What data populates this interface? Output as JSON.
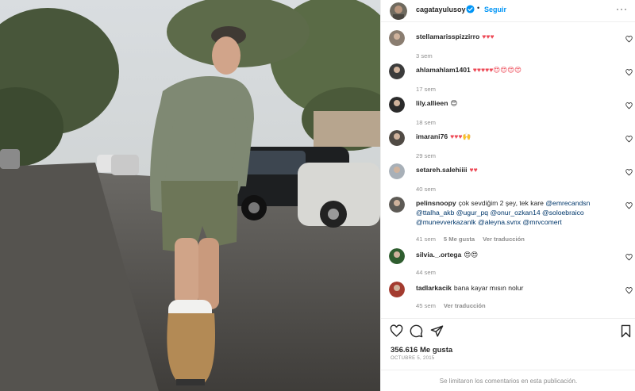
{
  "post": {
    "username": "cagatayulusoy",
    "follow_label": "Seguir",
    "separator": "•",
    "more_label": "···",
    "likes": "356.616 Me gusta",
    "date": "OCTUBRE 5, 2015",
    "comments_limited": "Se limitaron los comentarios en esta publicación."
  },
  "comments": [
    {
      "username": "stellamarisspizzirro",
      "text": "♥♥♥",
      "time": "3 sem",
      "likes": "",
      "action": ""
    },
    {
      "username": "ahlamahlam1401",
      "text": "♥♥♥♥♥😍😍😍😍",
      "time": "17 sem",
      "likes": "",
      "action": ""
    },
    {
      "username": "lily.allieen",
      "text": "😍",
      "time": "18 sem",
      "likes": "",
      "action": ""
    },
    {
      "username": "imarani76",
      "text": "♥♥♥🙌",
      "time": "29 sem",
      "likes": "",
      "action": ""
    },
    {
      "username": "setareh.salehiiii",
      "text": "♥♥",
      "time": "40 sem",
      "likes": "",
      "action": ""
    },
    {
      "username": "pelinsnoopy",
      "text_parts": [
        {
          "t": "çok sevdiğim 2 şey, tek kare ",
          "m": false
        },
        {
          "t": "@emrecandsn",
          "m": true
        },
        {
          "t": " ",
          "m": false
        },
        {
          "t": "@ttalha_akb",
          "m": true
        },
        {
          "t": " ",
          "m": false
        },
        {
          "t": "@ugur_pq",
          "m": true
        },
        {
          "t": " ",
          "m": false
        },
        {
          "t": "@onur_ozkan14",
          "m": true
        },
        {
          "t": " ",
          "m": false
        },
        {
          "t": "@soloebraico",
          "m": true
        },
        {
          "t": " ",
          "m": false
        },
        {
          "t": "@munevverkazanlk",
          "m": true
        },
        {
          "t": " ",
          "m": false
        },
        {
          "t": "@aleyna.svnx",
          "m": true
        },
        {
          "t": " ",
          "m": false
        },
        {
          "t": "@mrvcomert",
          "m": true
        }
      ],
      "time": "41 sem",
      "likes": "5 Me gusta",
      "action": "Ver traducción"
    },
    {
      "username": "silvia._.ortega",
      "text": "😍😍",
      "time": "44 sem",
      "likes": "",
      "action": ""
    },
    {
      "username": "tadlarkacik",
      "text": "bana kayar mısın nolur",
      "time": "45 sem",
      "likes": "",
      "action": "Ver traducción"
    }
  ],
  "colors": {
    "accent": "#0095f6",
    "heart_red": "#ed4956",
    "mention": "#00376b",
    "muted": "#8e8e8e"
  },
  "icons": {
    "verified": "verified-badge-icon",
    "like": "heart-outline-icon",
    "comment": "speech-bubble-icon",
    "share": "paper-plane-icon",
    "save": "bookmark-icon"
  }
}
